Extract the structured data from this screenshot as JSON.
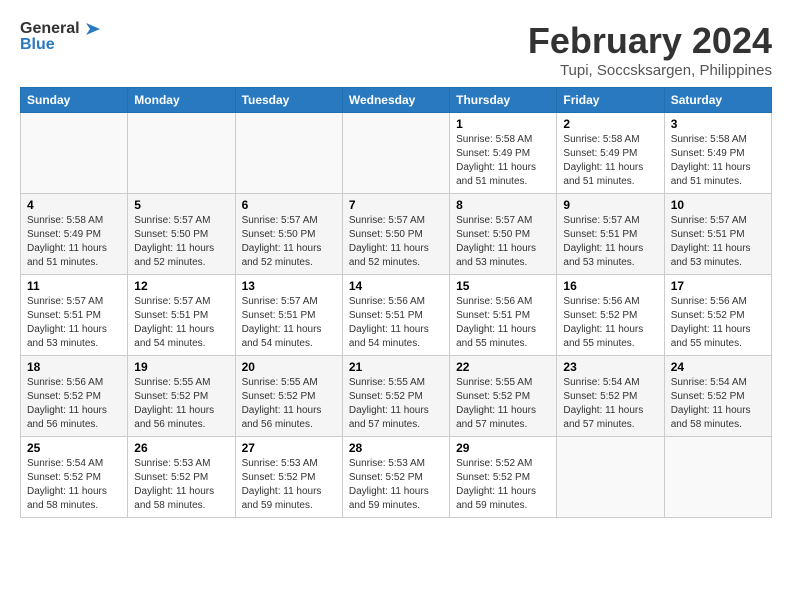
{
  "logo": {
    "general": "General",
    "blue": "Blue"
  },
  "title": "February 2024",
  "subtitle": "Tupi, Soccsksargen, Philippines",
  "days_of_week": [
    "Sunday",
    "Monday",
    "Tuesday",
    "Wednesday",
    "Thursday",
    "Friday",
    "Saturday"
  ],
  "weeks": [
    [
      {
        "day": "",
        "sunrise": "",
        "sunset": "",
        "daylight": ""
      },
      {
        "day": "",
        "sunrise": "",
        "sunset": "",
        "daylight": ""
      },
      {
        "day": "",
        "sunrise": "",
        "sunset": "",
        "daylight": ""
      },
      {
        "day": "",
        "sunrise": "",
        "sunset": "",
        "daylight": ""
      },
      {
        "day": "1",
        "sunrise": "Sunrise: 5:58 AM",
        "sunset": "Sunset: 5:49 PM",
        "daylight": "Daylight: 11 hours and 51 minutes."
      },
      {
        "day": "2",
        "sunrise": "Sunrise: 5:58 AM",
        "sunset": "Sunset: 5:49 PM",
        "daylight": "Daylight: 11 hours and 51 minutes."
      },
      {
        "day": "3",
        "sunrise": "Sunrise: 5:58 AM",
        "sunset": "Sunset: 5:49 PM",
        "daylight": "Daylight: 11 hours and 51 minutes."
      }
    ],
    [
      {
        "day": "4",
        "sunrise": "Sunrise: 5:58 AM",
        "sunset": "Sunset: 5:49 PM",
        "daylight": "Daylight: 11 hours and 51 minutes."
      },
      {
        "day": "5",
        "sunrise": "Sunrise: 5:57 AM",
        "sunset": "Sunset: 5:50 PM",
        "daylight": "Daylight: 11 hours and 52 minutes."
      },
      {
        "day": "6",
        "sunrise": "Sunrise: 5:57 AM",
        "sunset": "Sunset: 5:50 PM",
        "daylight": "Daylight: 11 hours and 52 minutes."
      },
      {
        "day": "7",
        "sunrise": "Sunrise: 5:57 AM",
        "sunset": "Sunset: 5:50 PM",
        "daylight": "Daylight: 11 hours and 52 minutes."
      },
      {
        "day": "8",
        "sunrise": "Sunrise: 5:57 AM",
        "sunset": "Sunset: 5:50 PM",
        "daylight": "Daylight: 11 hours and 53 minutes."
      },
      {
        "day": "9",
        "sunrise": "Sunrise: 5:57 AM",
        "sunset": "Sunset: 5:51 PM",
        "daylight": "Daylight: 11 hours and 53 minutes."
      },
      {
        "day": "10",
        "sunrise": "Sunrise: 5:57 AM",
        "sunset": "Sunset: 5:51 PM",
        "daylight": "Daylight: 11 hours and 53 minutes."
      }
    ],
    [
      {
        "day": "11",
        "sunrise": "Sunrise: 5:57 AM",
        "sunset": "Sunset: 5:51 PM",
        "daylight": "Daylight: 11 hours and 53 minutes."
      },
      {
        "day": "12",
        "sunrise": "Sunrise: 5:57 AM",
        "sunset": "Sunset: 5:51 PM",
        "daylight": "Daylight: 11 hours and 54 minutes."
      },
      {
        "day": "13",
        "sunrise": "Sunrise: 5:57 AM",
        "sunset": "Sunset: 5:51 PM",
        "daylight": "Daylight: 11 hours and 54 minutes."
      },
      {
        "day": "14",
        "sunrise": "Sunrise: 5:56 AM",
        "sunset": "Sunset: 5:51 PM",
        "daylight": "Daylight: 11 hours and 54 minutes."
      },
      {
        "day": "15",
        "sunrise": "Sunrise: 5:56 AM",
        "sunset": "Sunset: 5:51 PM",
        "daylight": "Daylight: 11 hours and 55 minutes."
      },
      {
        "day": "16",
        "sunrise": "Sunrise: 5:56 AM",
        "sunset": "Sunset: 5:52 PM",
        "daylight": "Daylight: 11 hours and 55 minutes."
      },
      {
        "day": "17",
        "sunrise": "Sunrise: 5:56 AM",
        "sunset": "Sunset: 5:52 PM",
        "daylight": "Daylight: 11 hours and 55 minutes."
      }
    ],
    [
      {
        "day": "18",
        "sunrise": "Sunrise: 5:56 AM",
        "sunset": "Sunset: 5:52 PM",
        "daylight": "Daylight: 11 hours and 56 minutes."
      },
      {
        "day": "19",
        "sunrise": "Sunrise: 5:55 AM",
        "sunset": "Sunset: 5:52 PM",
        "daylight": "Daylight: 11 hours and 56 minutes."
      },
      {
        "day": "20",
        "sunrise": "Sunrise: 5:55 AM",
        "sunset": "Sunset: 5:52 PM",
        "daylight": "Daylight: 11 hours and 56 minutes."
      },
      {
        "day": "21",
        "sunrise": "Sunrise: 5:55 AM",
        "sunset": "Sunset: 5:52 PM",
        "daylight": "Daylight: 11 hours and 57 minutes."
      },
      {
        "day": "22",
        "sunrise": "Sunrise: 5:55 AM",
        "sunset": "Sunset: 5:52 PM",
        "daylight": "Daylight: 11 hours and 57 minutes."
      },
      {
        "day": "23",
        "sunrise": "Sunrise: 5:54 AM",
        "sunset": "Sunset: 5:52 PM",
        "daylight": "Daylight: 11 hours and 57 minutes."
      },
      {
        "day": "24",
        "sunrise": "Sunrise: 5:54 AM",
        "sunset": "Sunset: 5:52 PM",
        "daylight": "Daylight: 11 hours and 58 minutes."
      }
    ],
    [
      {
        "day": "25",
        "sunrise": "Sunrise: 5:54 AM",
        "sunset": "Sunset: 5:52 PM",
        "daylight": "Daylight: 11 hours and 58 minutes."
      },
      {
        "day": "26",
        "sunrise": "Sunrise: 5:53 AM",
        "sunset": "Sunset: 5:52 PM",
        "daylight": "Daylight: 11 hours and 58 minutes."
      },
      {
        "day": "27",
        "sunrise": "Sunrise: 5:53 AM",
        "sunset": "Sunset: 5:52 PM",
        "daylight": "Daylight: 11 hours and 59 minutes."
      },
      {
        "day": "28",
        "sunrise": "Sunrise: 5:53 AM",
        "sunset": "Sunset: 5:52 PM",
        "daylight": "Daylight: 11 hours and 59 minutes."
      },
      {
        "day": "29",
        "sunrise": "Sunrise: 5:52 AM",
        "sunset": "Sunset: 5:52 PM",
        "daylight": "Daylight: 11 hours and 59 minutes."
      },
      {
        "day": "",
        "sunrise": "",
        "sunset": "",
        "daylight": ""
      },
      {
        "day": "",
        "sunrise": "",
        "sunset": "",
        "daylight": ""
      }
    ]
  ]
}
